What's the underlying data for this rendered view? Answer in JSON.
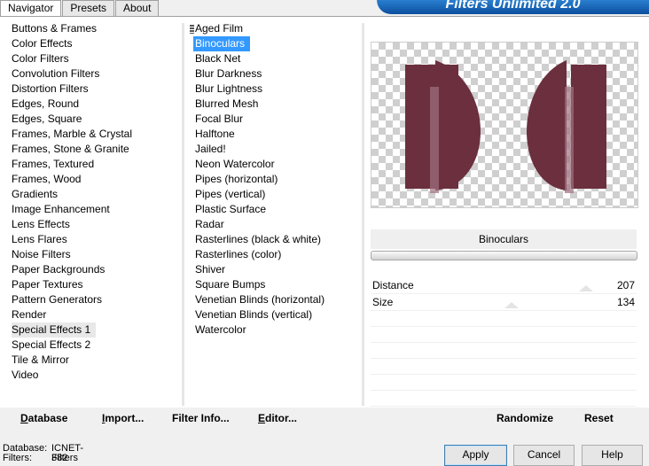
{
  "tabs": [
    {
      "label": "Navigator"
    },
    {
      "label": "Presets"
    },
    {
      "label": "About"
    }
  ],
  "banner_title": "Filters Unlimited 2.0",
  "categories": [
    "Buttons & Frames",
    "Color Effects",
    "Color Filters",
    "Convolution Filters",
    "Distortion Filters",
    "Edges, Round",
    "Edges, Square",
    "Frames, Marble & Crystal",
    "Frames, Stone & Granite",
    "Frames, Textured",
    "Frames, Wood",
    "Gradients",
    "Image Enhancement",
    "Lens Effects",
    "Lens Flares",
    "Noise Filters",
    "Paper Backgrounds",
    "Paper Textures",
    "Pattern Generators",
    "Render",
    "Special Effects 1",
    "Special Effects 2",
    "Tile & Mirror",
    "Video"
  ],
  "selected_category": "Special Effects 1",
  "filters": [
    "Aged Film",
    "Binoculars",
    "Black Net",
    "Blur Darkness",
    "Blur Lightness",
    "Blurred Mesh",
    "Focal Blur",
    "Halftone",
    "Jailed!",
    "Neon Watercolor",
    "Pipes (horizontal)",
    "Pipes (vertical)",
    "Plastic Surface",
    "Radar",
    "Rasterlines (black & white)",
    "Rasterlines (color)",
    "Shiver",
    "Square Bumps",
    "Venetian Blinds (horizontal)",
    "Venetian Blinds (vertical)",
    "Watercolor"
  ],
  "selected_filter": "Binoculars",
  "filter_name": "Binoculars",
  "params": [
    {
      "label": "Distance",
      "value": "207",
      "level": 0.81
    },
    {
      "label": "Size",
      "value": "134",
      "level": 0.53
    }
  ],
  "bottom": {
    "database": "Database",
    "import": "Import...",
    "filter_info": "Filter Info...",
    "editor": "Editor...",
    "randomize": "Randomize",
    "reset": "Reset"
  },
  "status": {
    "database_label": "Database:",
    "database_value": "ICNET-Filters",
    "filters_label": "Filters:",
    "filters_value": "382"
  },
  "buttons": {
    "apply": "Apply",
    "cancel": "Cancel",
    "help": "Help"
  },
  "colors": {
    "selection": "#3399ff",
    "preview_shape": "#6b2f3e",
    "banner": "#0b4f9e"
  },
  "icons": {
    "filter_grip": "drag-grip-icon"
  }
}
